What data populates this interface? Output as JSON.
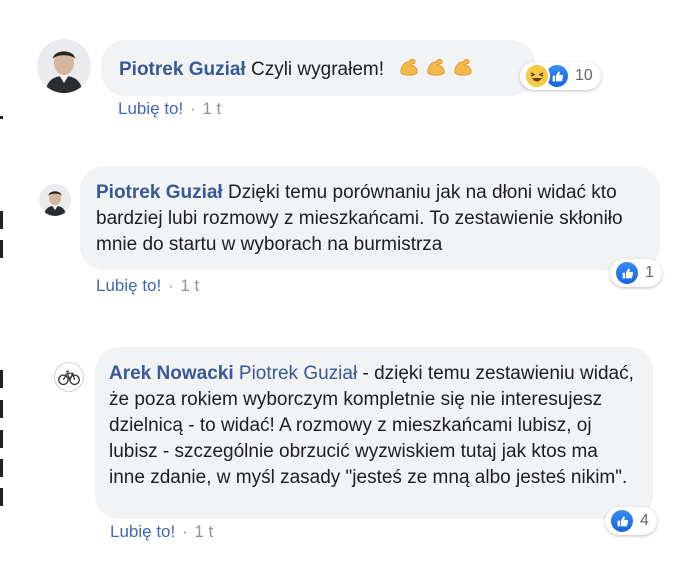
{
  "comments": [
    {
      "author": "Piotrek Guział",
      "text": "Czyli wygrałem!",
      "emojis": [
        "flexed-biceps-icon",
        "flexed-biceps-icon",
        "flexed-biceps-icon"
      ],
      "reactions": {
        "types": [
          "haha",
          "like"
        ],
        "count": "10"
      },
      "like_label": "Lubię to!",
      "separator": "·",
      "time": "1 t"
    },
    {
      "author": "Piotrek Guział",
      "text": "Dzięki temu porównaniu jak na dłoni widać kto bardziej lubi rozmowy z mieszkańcami. To zestawienie skłoniło mnie do startu w wyborach na burmistrza",
      "reactions": {
        "types": [
          "like"
        ],
        "count": "1"
      },
      "like_label": "Lubię to!",
      "separator": "·",
      "time": "1 t"
    },
    {
      "author": "Arek Nowacki",
      "mention": "Piotrek Guział",
      "text": "- dzięki temu zestawieniu widać, że poza rokiem wyborczym kompletnie się nie interesujesz dzielnicą - to widać! A rozmowy z mieszkańcami lubisz, oj lubisz - szczególnie obrzucić wyzwiskiem tutaj jak ktos ma inne zdanie, w myśl zasady \"jesteś ze mną albo jesteś nikim\".",
      "reactions": {
        "types": [
          "like"
        ],
        "count": "4"
      },
      "like_label": "Lubię to!",
      "separator": "·",
      "time": "1 t"
    }
  ],
  "colors": {
    "author": "#385898",
    "bubble": "#f2f3f5",
    "like_blue": "#1877f2",
    "meta_grey": "#8d949e"
  }
}
